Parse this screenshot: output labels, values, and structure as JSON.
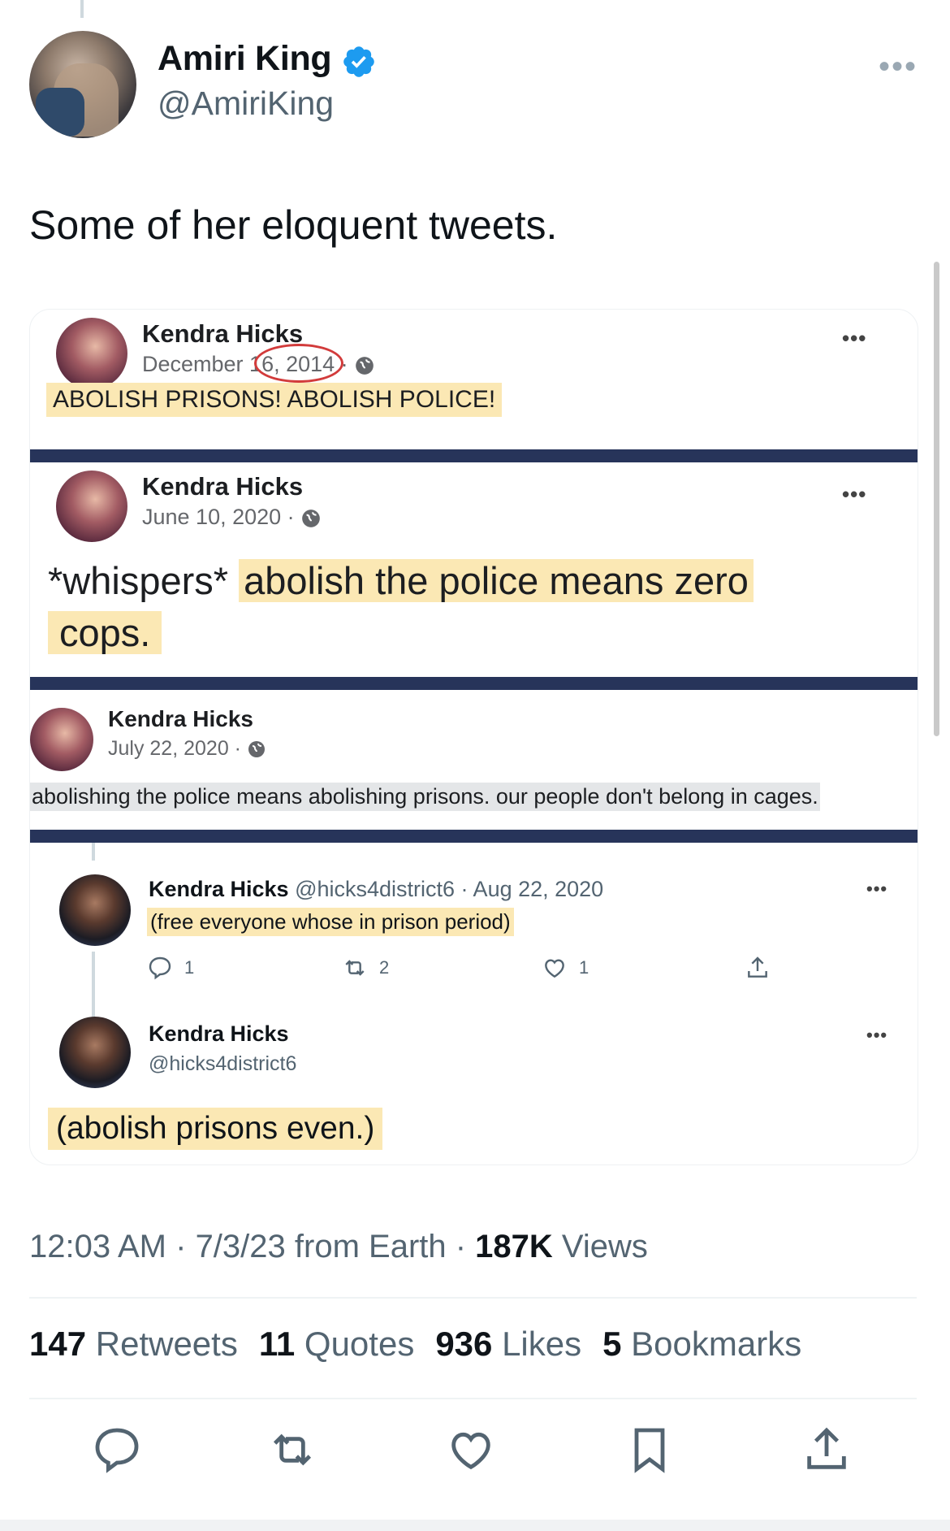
{
  "author": {
    "display_name": "Amiri King",
    "handle": "@AmiriKing",
    "verified": true
  },
  "tweet": {
    "text": "Some of her eloquent tweets.",
    "time": "12:03 AM",
    "date": "7/3/23",
    "source": "from Earth",
    "views_count": "187K",
    "views_label": "Views"
  },
  "stats": {
    "retweets_count": "147",
    "retweets_label": "Retweets",
    "quotes_count": "11",
    "quotes_label": "Quotes",
    "likes_count": "936",
    "likes_label": "Likes",
    "bookmarks_count": "5",
    "bookmarks_label": "Bookmarks"
  },
  "media": {
    "post1": {
      "name": "Kendra Hicks",
      "date": "December 16, 2014 ·",
      "text": "ABOLISH PRISONS! ABOLISH POLICE!"
    },
    "post2": {
      "name": "Kendra Hicks",
      "date": "June 10, 2020 ·",
      "text_plain": "*whispers* ",
      "text_highlight_1": "abolish the police means zero",
      "text_highlight_2": "cops."
    },
    "post3": {
      "name": "Kendra Hicks",
      "date": "July 22, 2020 ·",
      "text": "abolishing the police means abolishing prisons. our people don't belong in cages."
    },
    "post4": {
      "name": "Kendra Hicks",
      "meta": "@hicks4district6 · Aug 22, 2020",
      "text": "(free everyone whose in prison period)",
      "replies": "1",
      "retweets": "2",
      "likes": "1"
    },
    "post5": {
      "name": "Kendra Hicks",
      "handle": "@hicks4district6",
      "text": "(abolish prisons even.)"
    }
  },
  "colors": {
    "verified_blue": "#1d9bf0",
    "separator_navy": "#27345a",
    "highlight": "#fbe8b4",
    "circle_red": "#d23b3b"
  },
  "icons": [
    "verified-badge-icon",
    "more-icon",
    "globe-icon",
    "reply-icon",
    "retweet-icon",
    "like-icon",
    "bookmark-icon",
    "share-icon"
  ]
}
